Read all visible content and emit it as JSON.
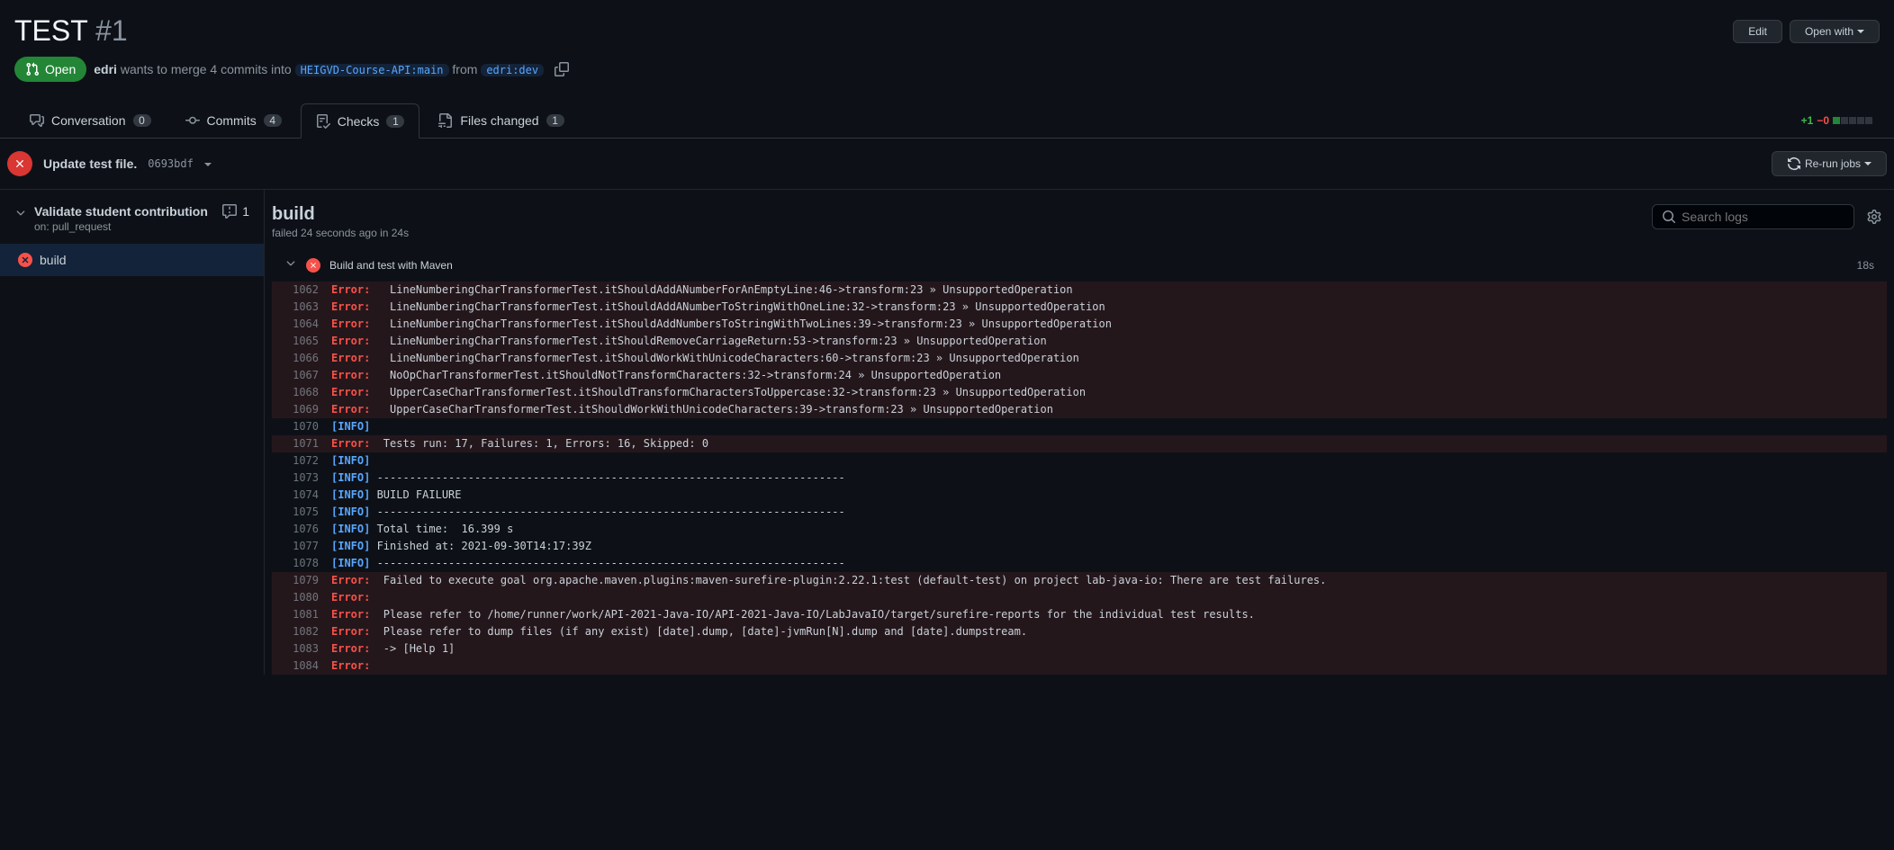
{
  "header": {
    "title": "TEST",
    "number": "#1",
    "edit_label": "Edit",
    "open_with_label": "Open with"
  },
  "state": {
    "label": "Open"
  },
  "merge_info": {
    "author": "edri",
    "middle": "wants to merge 4 commits into",
    "base": "HEIGVD-Course-API:main",
    "from_word": "from",
    "head": "edri:dev"
  },
  "tabs": {
    "conversation": {
      "label": "Conversation",
      "count": "0"
    },
    "commits": {
      "label": "Commits",
      "count": "4"
    },
    "checks": {
      "label": "Checks",
      "count": "1"
    },
    "files": {
      "label": "Files changed",
      "count": "1"
    }
  },
  "diffstat": {
    "add": "+1",
    "del": "−0"
  },
  "commit": {
    "title": "Update test file.",
    "sha": "0693bdf",
    "rerun_label": "Re-run jobs"
  },
  "workflow": {
    "name": "Validate student contribution",
    "sub": "on: pull_request",
    "annot_count": "1",
    "job_name": "build"
  },
  "job": {
    "title": "build",
    "sub": "failed 24 seconds ago in 24s",
    "search_placeholder": "Search logs",
    "step_name": "Build and test with Maven",
    "step_time": "18s"
  },
  "log": [
    {
      "n": "1062",
      "hl": true,
      "tag": "Error:",
      "txt": "   LineNumberingCharTransformerTest.itShouldAddANumberForAnEmptyLine:46->transform:23 » UnsupportedOperation"
    },
    {
      "n": "1063",
      "hl": true,
      "tag": "Error:",
      "txt": "   LineNumberingCharTransformerTest.itShouldAddANumberToStringWithOneLine:32->transform:23 » UnsupportedOperation"
    },
    {
      "n": "1064",
      "hl": true,
      "tag": "Error:",
      "txt": "   LineNumberingCharTransformerTest.itShouldAddNumbersToStringWithTwoLines:39->transform:23 » UnsupportedOperation"
    },
    {
      "n": "1065",
      "hl": true,
      "tag": "Error:",
      "txt": "   LineNumberingCharTransformerTest.itShouldRemoveCarriageReturn:53->transform:23 » UnsupportedOperation"
    },
    {
      "n": "1066",
      "hl": true,
      "tag": "Error:",
      "txt": "   LineNumberingCharTransformerTest.itShouldWorkWithUnicodeCharacters:60->transform:23 » UnsupportedOperation"
    },
    {
      "n": "1067",
      "hl": true,
      "tag": "Error:",
      "txt": "   NoOpCharTransformerTest.itShouldNotTransformCharacters:32->transform:24 » UnsupportedOperation"
    },
    {
      "n": "1068",
      "hl": true,
      "tag": "Error:",
      "txt": "   UpperCaseCharTransformerTest.itShouldTransformCharactersToUppercase:32->transform:23 » UnsupportedOperation"
    },
    {
      "n": "1069",
      "hl": true,
      "tag": "Error:",
      "txt": "   UpperCaseCharTransformerTest.itShouldWorkWithUnicodeCharacters:39->transform:23 » UnsupportedOperation"
    },
    {
      "n": "1070",
      "hl": false,
      "tag": "[INFO]",
      "txt": " "
    },
    {
      "n": "1071",
      "hl": true,
      "tag": "Error:",
      "txt": "  Tests run: 17, Failures: 1, Errors: 16, Skipped: 0"
    },
    {
      "n": "1072",
      "hl": false,
      "tag": "[INFO]",
      "txt": " "
    },
    {
      "n": "1073",
      "hl": false,
      "tag": "[INFO]",
      "txt": " ------------------------------------------------------------------------"
    },
    {
      "n": "1074",
      "hl": false,
      "tag": "[INFO]",
      "txt": " BUILD FAILURE"
    },
    {
      "n": "1075",
      "hl": false,
      "tag": "[INFO]",
      "txt": " ------------------------------------------------------------------------"
    },
    {
      "n": "1076",
      "hl": false,
      "tag": "[INFO]",
      "txt": " Total time:  16.399 s"
    },
    {
      "n": "1077",
      "hl": false,
      "tag": "[INFO]",
      "txt": " Finished at: 2021-09-30T14:17:39Z"
    },
    {
      "n": "1078",
      "hl": false,
      "tag": "[INFO]",
      "txt": " ------------------------------------------------------------------------"
    },
    {
      "n": "1079",
      "hl": true,
      "tag": "Error:",
      "txt": "  Failed to execute goal org.apache.maven.plugins:maven-surefire-plugin:2.22.1:test (default-test) on project lab-java-io: There are test failures."
    },
    {
      "n": "1080",
      "hl": true,
      "tag": "Error:",
      "txt": "  "
    },
    {
      "n": "1081",
      "hl": true,
      "tag": "Error:",
      "txt": "  Please refer to /home/runner/work/API-2021-Java-IO/API-2021-Java-IO/LabJavaIO/target/surefire-reports for the individual test results."
    },
    {
      "n": "1082",
      "hl": true,
      "tag": "Error:",
      "txt": "  Please refer to dump files (if any exist) [date].dump, [date]-jvmRun[N].dump and [date].dumpstream."
    },
    {
      "n": "1083",
      "hl": true,
      "tag": "Error:",
      "txt": "  -> [Help 1]"
    },
    {
      "n": "1084",
      "hl": true,
      "tag": "Error:",
      "txt": "  "
    }
  ]
}
